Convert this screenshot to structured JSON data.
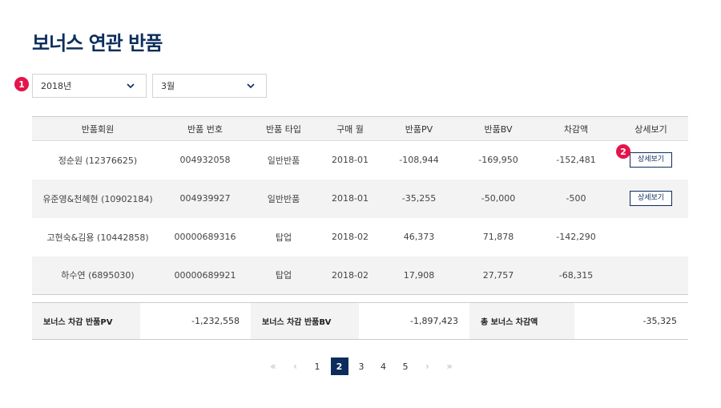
{
  "page": {
    "title": "보너스 연관 반품"
  },
  "badges": [
    "1",
    "2"
  ],
  "filters": {
    "year": "2018년",
    "month": "3월"
  },
  "table": {
    "headers": [
      "반품회원",
      "반품 번호",
      "반품 타입",
      "구매 월",
      "반품PV",
      "반품BV",
      "차감액",
      "상세보기"
    ],
    "rows": [
      {
        "member": "정순원 (12376625)",
        "return_no": "004932058",
        "type": "일반반품",
        "month": "2018-01",
        "pv": "-108,944",
        "bv": "-169,950",
        "deduction": "-152,481",
        "detail": "상세보기"
      },
      {
        "member": "유준영&천혜현 (10902184)",
        "return_no": "004939927",
        "type": "일반반품",
        "month": "2018-01",
        "pv": "-35,255",
        "bv": "-50,000",
        "deduction": "-500",
        "detail": "상세보기"
      },
      {
        "member": "고현숙&김용 (10442858)",
        "return_no": "00000689316",
        "type": "탑업",
        "month": "2018-02",
        "pv": "46,373",
        "bv": "71,878",
        "deduction": "-142,290",
        "detail": ""
      },
      {
        "member": "하수연 (6895030)",
        "return_no": "00000689921",
        "type": "탑업",
        "month": "2018-02",
        "pv": "17,908",
        "bv": "27,757",
        "deduction": "-68,315",
        "detail": ""
      }
    ]
  },
  "summary": {
    "pv_label": "보너스 차감 반품PV",
    "pv_value": "-1,232,558",
    "bv_label": "보너스 차감 반품BV",
    "bv_value": "-1,897,423",
    "total_label": "총 보너스 차감액",
    "total_value": "-35,325"
  },
  "pagination": {
    "first": "«",
    "prev": "‹",
    "pages": [
      "1",
      "2",
      "3",
      "4",
      "5"
    ],
    "current": "2",
    "next": "›",
    "last": "»"
  },
  "colors": {
    "navy": "#0c2d5c",
    "badge": "#e4154b",
    "row_alt": "#f3f3f3"
  }
}
